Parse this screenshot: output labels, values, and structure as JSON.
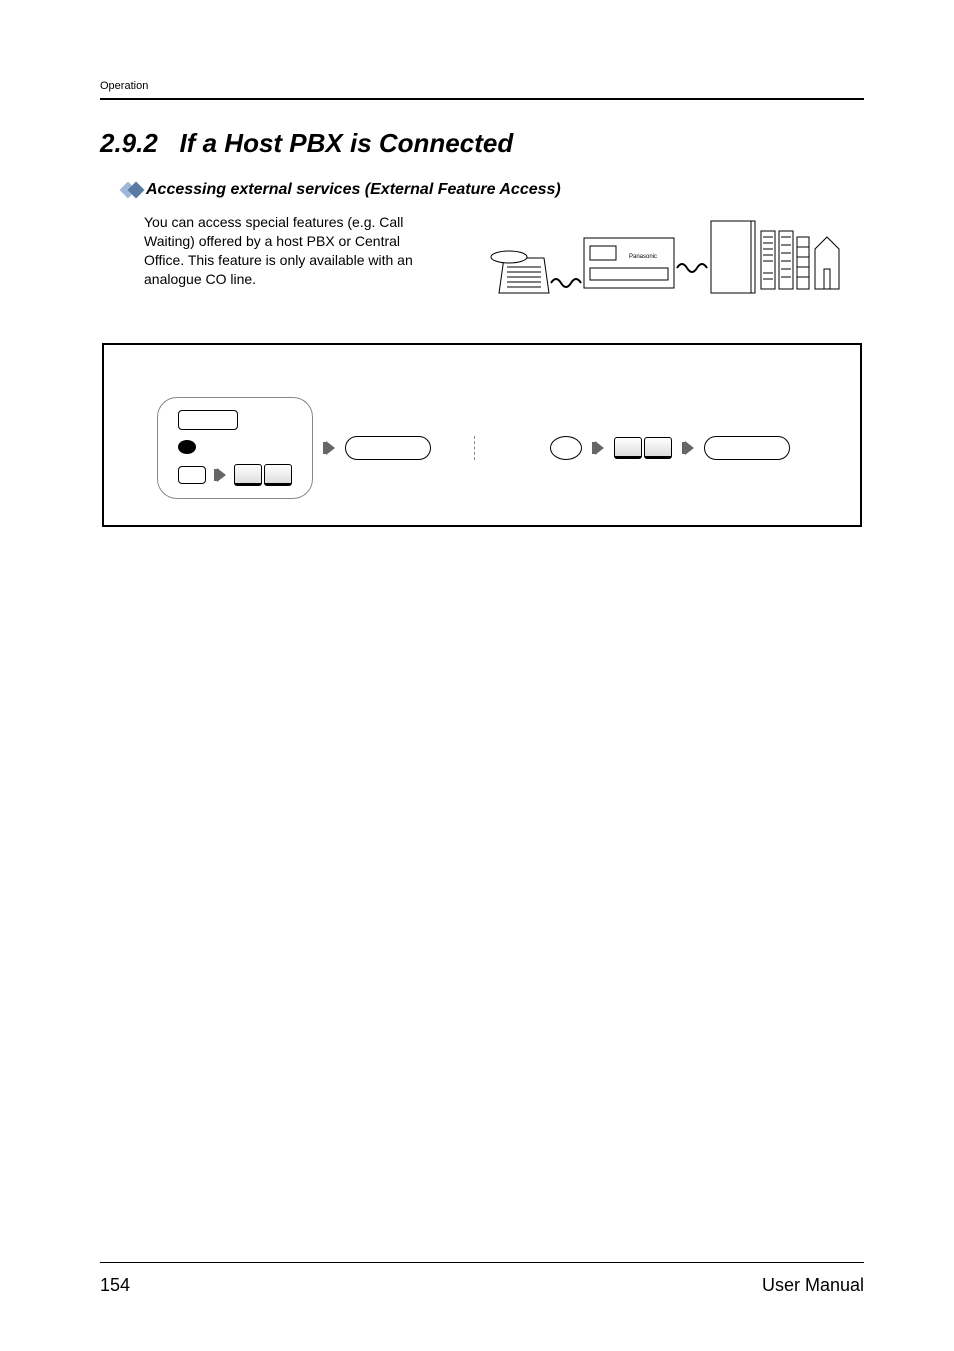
{
  "header": {
    "running": "Operation"
  },
  "section": {
    "number": "2.9.2",
    "title": "If a Host PBX is Connected"
  },
  "subsection": {
    "title": "Accessing external services (External Feature Access)"
  },
  "intro": {
    "text": "You can access special features (e.g. Call Waiting) offered by a host PBX or Central Office. This feature is only available with an analogue CO line."
  },
  "footer": {
    "page_number": "154",
    "doc_title": "User Manual"
  }
}
